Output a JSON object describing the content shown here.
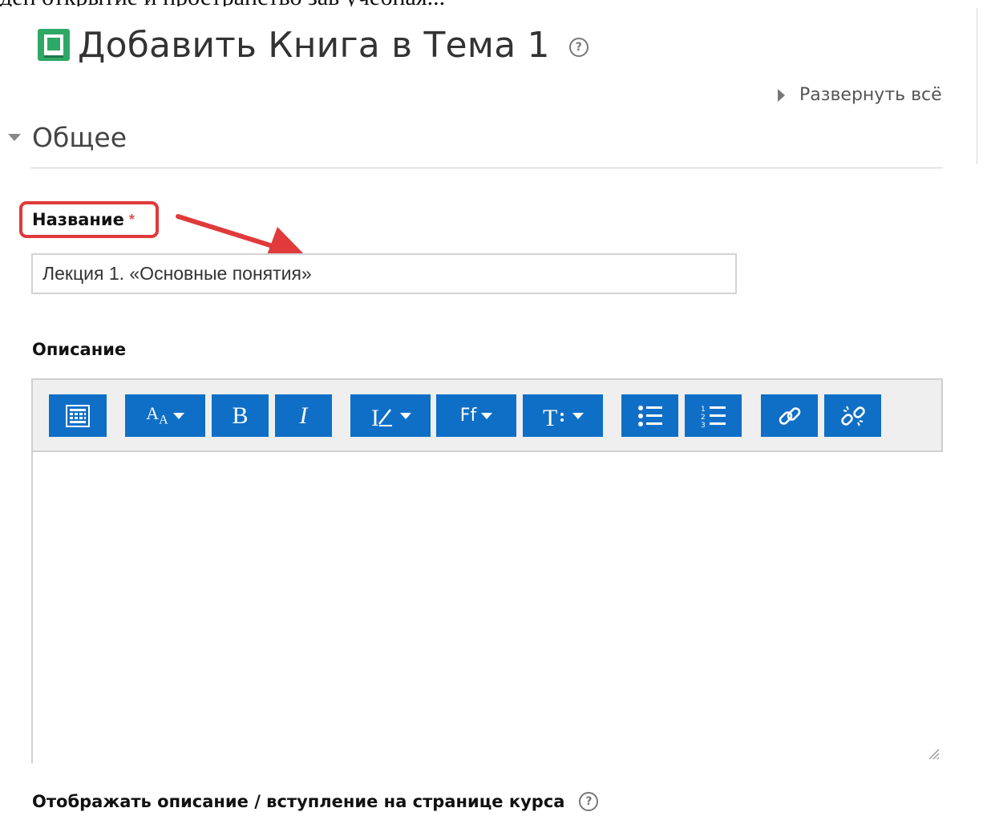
{
  "top_strip_text": "ден открытие и пространство зав учебная...",
  "header": {
    "title": "Добавить Книга в Тема 1",
    "help_icon": "help-circle-icon",
    "book_icon": "book-icon",
    "book_icon_color": "#2ea866"
  },
  "expand_all": "Развернуть всё",
  "section": {
    "title": "Общее"
  },
  "name_field": {
    "label": "Название",
    "required_mark": "*",
    "value": "Лекция 1. «Основные понятия»"
  },
  "description_field": {
    "label": "Описание"
  },
  "toolbar": {
    "accent_color": "#0f6fc6",
    "buttons": [
      {
        "id": "toolbar-toggle",
        "icon": "show-more-buttons-icon"
      },
      {
        "id": "font-size",
        "icon": "font-size-icon",
        "dropdown": true
      },
      {
        "id": "bold",
        "glyph": "B"
      },
      {
        "id": "italic",
        "glyph": "I"
      },
      {
        "id": "text-style",
        "icon": "text-style-icon",
        "dropdown": true
      },
      {
        "id": "font-family",
        "glyph": "Ff",
        "dropdown": true
      },
      {
        "id": "font-color",
        "icon": "text-format-icon",
        "dropdown": true
      },
      {
        "id": "unordered-list",
        "icon": "bullet-list-icon"
      },
      {
        "id": "ordered-list",
        "icon": "numbered-list-icon"
      },
      {
        "id": "link",
        "icon": "link-icon"
      },
      {
        "id": "unlink",
        "icon": "unlink-icon"
      }
    ]
  },
  "show_description": {
    "label": "Отображать описание / вступление на странице курса"
  },
  "annotation": {
    "color": "#e03a3a"
  }
}
